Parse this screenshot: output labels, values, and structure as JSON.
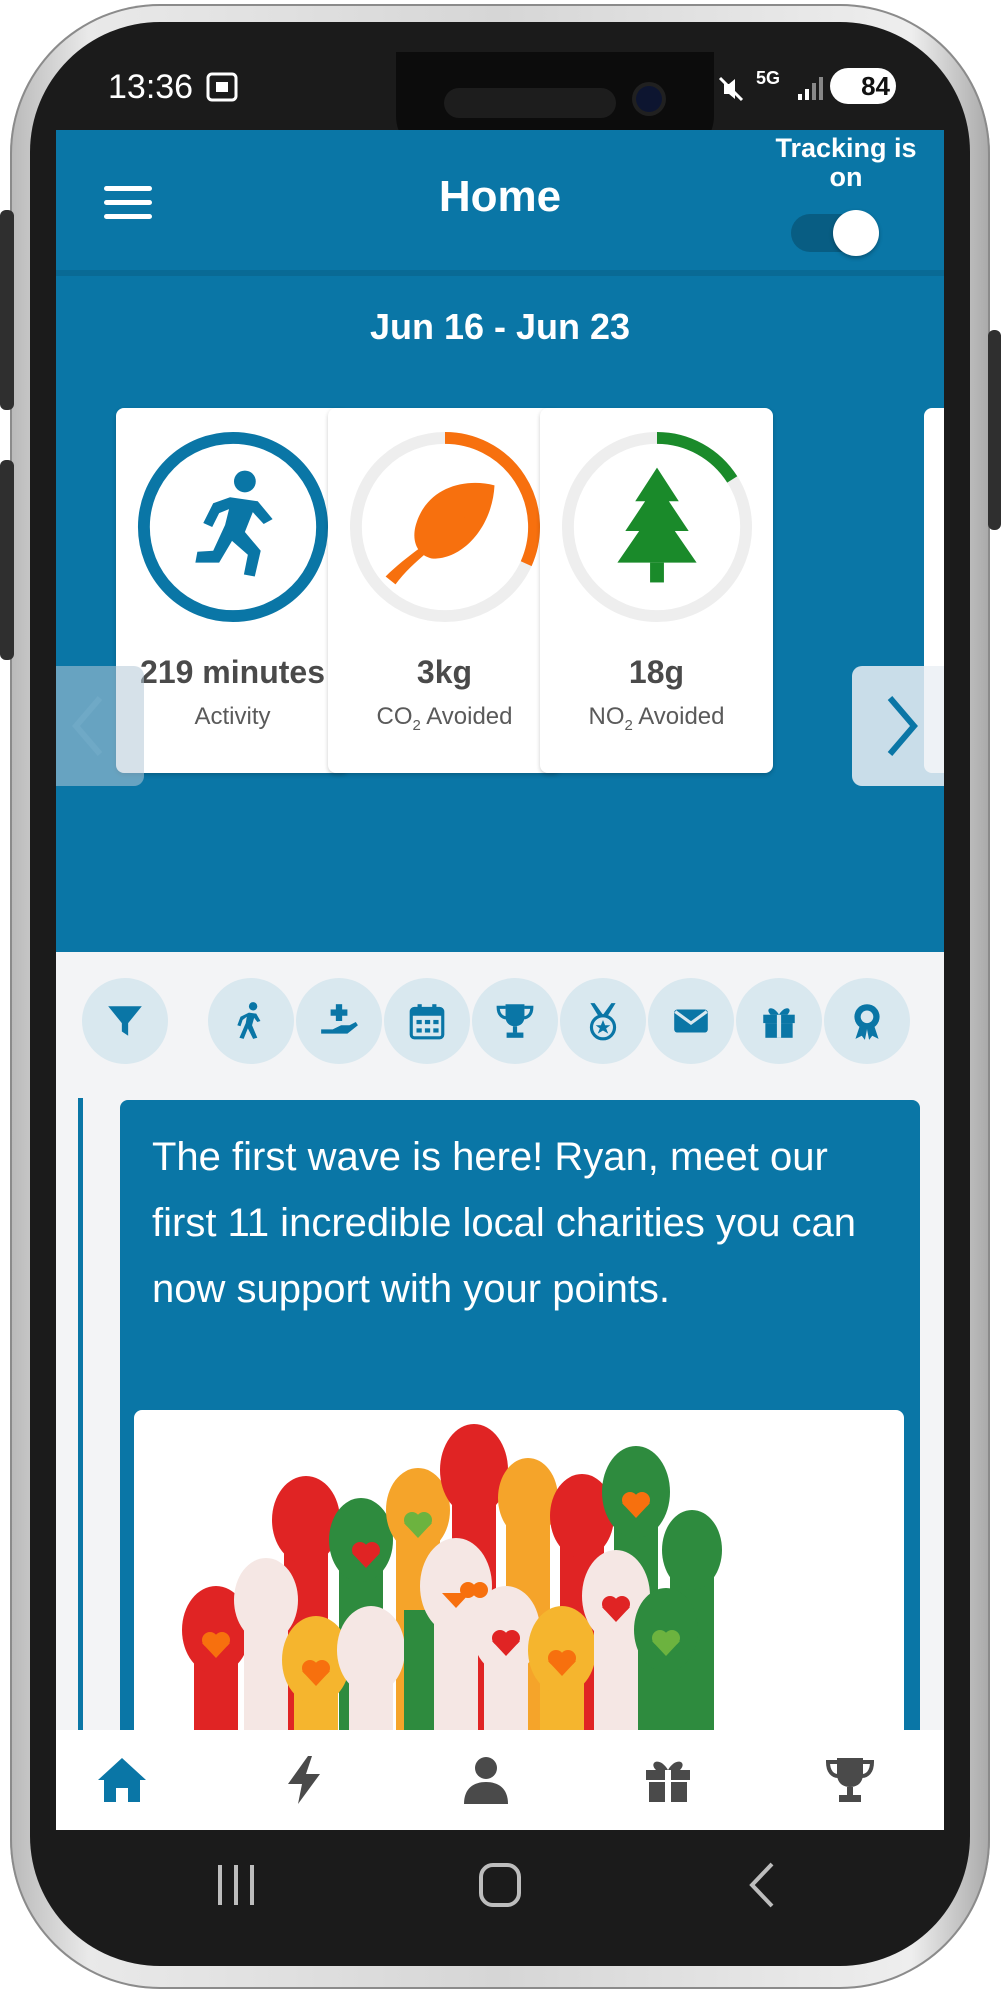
{
  "status_bar": {
    "time": "13:36",
    "battery": "84",
    "network": "5G"
  },
  "header": {
    "title": "Home",
    "tracking_label": "Tracking is on",
    "tracking_on": true
  },
  "stats": {
    "date_range": "Jun 16 - Jun 23",
    "cards": [
      {
        "value": "219 minutes",
        "label": "Activity",
        "icon": "running-person-icon",
        "color": "#0a76a6",
        "progress": 1.0
      },
      {
        "value": "3kg",
        "label": "CO",
        "label_sub": "2",
        "label_suffix": " Avoided",
        "icon": "leaf-icon",
        "color": "#f7700e",
        "progress": 0.4
      },
      {
        "value": "18g",
        "label": "NO",
        "label_sub": "2",
        "label_suffix": " Avoided",
        "icon": "tree-icon",
        "color": "#1a8a2a",
        "progress": 0.22
      }
    ]
  },
  "filters": [
    "filter-icon",
    "walking-icon",
    "hand-donate-icon",
    "calendar-icon",
    "trophy-icon",
    "medal-icon",
    "mail-icon",
    "gift-icon",
    "award-icon"
  ],
  "feed": {
    "message": "The first wave is here! Ryan, meet our first 11 incredible local charities you can now support with your points."
  },
  "bottom_nav": [
    "home-icon",
    "bolt-icon",
    "profile-icon",
    "gift-icon",
    "trophy-icon"
  ],
  "colors": {
    "primary": "#0a76a6",
    "chip_bg": "#d9e8ef",
    "orange": "#f7700e",
    "green": "#1a8a2a"
  }
}
